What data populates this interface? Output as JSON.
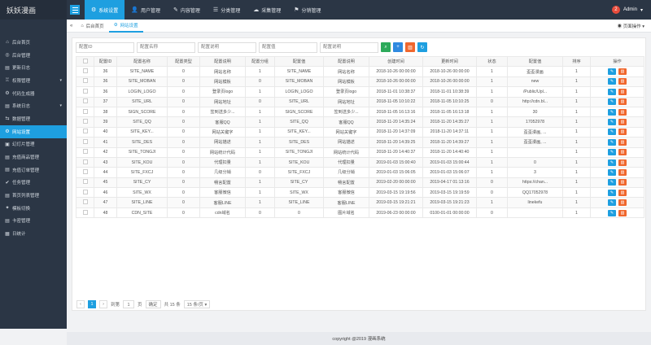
{
  "app": {
    "logo": "妖妖漫画",
    "user": "Admin",
    "avatar_letter": "2"
  },
  "colors": {
    "accent": "#1e9fe0",
    "sidebar": "#2b3645",
    "edit": "#1e9fe0",
    "delete": "#f0672d",
    "search": "#2daa5b"
  },
  "topnav": [
    {
      "label": "系统设置",
      "icon": "⚙"
    },
    {
      "label": "用户管理",
      "icon": "👤"
    },
    {
      "label": "内容管理",
      "icon": "✎"
    },
    {
      "label": "分类管理",
      "icon": "☰"
    },
    {
      "label": "采集管理",
      "icon": "☁"
    },
    {
      "label": "分销管理",
      "icon": "⚑"
    }
  ],
  "sidebar": [
    {
      "label": "后台首页",
      "icon": "⌂"
    },
    {
      "label": "后台管理",
      "icon": "◎"
    },
    {
      "label": "更新日志",
      "icon": "▤"
    },
    {
      "label": "权限管理",
      "icon": "♖",
      "arrow": "▾"
    },
    {
      "label": "代码生成器",
      "icon": "⚙"
    },
    {
      "label": "系统日志",
      "icon": "▤",
      "arrow": "▾"
    },
    {
      "label": "数据管理",
      "icon": "⇆"
    },
    {
      "label": "网站设置",
      "icon": "⚙",
      "active": true
    },
    {
      "label": "幻灯片管理",
      "icon": "▣"
    },
    {
      "label": "充值商品管理",
      "icon": "▤"
    },
    {
      "label": "充值订单管理",
      "icon": "▤"
    },
    {
      "label": "任务管理",
      "icon": "✔"
    },
    {
      "label": "首页列表管理",
      "icon": "▤"
    },
    {
      "label": "模板切换",
      "icon": "✦"
    },
    {
      "label": "卡密管理",
      "icon": "▤"
    },
    {
      "label": "日统计",
      "icon": "▦"
    }
  ],
  "tabs": [
    {
      "label": "后台首页",
      "icon": "⌂"
    },
    {
      "label": "网站设置",
      "icon": "⚙"
    }
  ],
  "page_op": "页面操作",
  "search": {
    "placeholders": [
      "配置ID",
      "配置名称",
      "配置说明",
      "配置值",
      "配置说明"
    ]
  },
  "table": {
    "headers": [
      "",
      "配置ID",
      "配置名称",
      "配置类型",
      "配置说明",
      "配置分组",
      "配置值",
      "配置说明",
      "创建时间",
      "更新时间",
      "状态",
      "配置值",
      "排序",
      "操作"
    ],
    "rows": [
      [
        "36",
        "SITE_NAME",
        "0",
        "网站名称",
        "1",
        "SITE_NAME",
        "网站名称",
        "2018-10-26 00:00:00",
        "2018-10-26 00:00:00",
        "1",
        "歪歪漫画",
        "1"
      ],
      [
        "36",
        "SITE_MOBAN",
        "0",
        "网站模板",
        "0",
        "SITE_MOBAN",
        "网站模板",
        "2018-10-26 00:00:00",
        "2018-10-26 00:00:00",
        "1",
        "new",
        "1"
      ],
      [
        "36",
        "LOGIN_LOGO",
        "0",
        "登录页logo",
        "1",
        "LOGIN_LOGO",
        "登录页logo",
        "2018-11-01 10:38:37",
        "2018-11-01 10:38:39",
        "1",
        "/Public/Upl...",
        "1"
      ],
      [
        "37",
        "SITE_URL",
        "0",
        "网站地址",
        "0",
        "SITE_URL",
        "网站地址",
        "2018-11-05 10:10:22",
        "2018-11-05 10:10:25",
        "0",
        "http://cdn.bl...",
        "1"
      ],
      [
        "38",
        "SIGN_SCORE",
        "0",
        "签到送多少...",
        "1",
        "SIGN_SCORE",
        "签到送多少...",
        "2018-11-05 16:13:16",
        "2018-11-05 16:13:18",
        "1",
        "30",
        "1"
      ],
      [
        "39",
        "SITE_QQ",
        "0",
        "客服QQ",
        "1",
        "SITE_QQ",
        "客服QQ",
        "2018-11-20 14:35:24",
        "2018-11-20 14:35:27",
        "1",
        "17052978",
        "1"
      ],
      [
        "40",
        "SITE_KEY...",
        "0",
        "网站关键字",
        "1",
        "SITE_KEY...",
        "网站关键字",
        "2018-11-20 14:37:09",
        "2018-11-20 14:37:11",
        "1",
        "歪歪漫画, ...",
        "1"
      ],
      [
        "41",
        "SITE_DES",
        "0",
        "网站描述",
        "1",
        "SITE_DES",
        "网站描述",
        "2018-11-20 14:39:25",
        "2018-11-20 14:39:27",
        "1",
        "歪歪漫画, ...",
        "1"
      ],
      [
        "42",
        "SITE_TONGJI",
        "0",
        "网站统计代码",
        "1",
        "SITE_TONGJI",
        "网站统计代码",
        "2018-11-20 14:40:37",
        "2018-11-20 14:40:40",
        "1",
        "",
        "1"
      ],
      [
        "43",
        "SITE_KOU",
        "0",
        "代理扣量",
        "1",
        "SITE_KOU",
        "代理扣量",
        "2019-01-03 15:00:40",
        "2019-01-03 15:00:44",
        "1",
        "0",
        "1"
      ],
      [
        "44",
        "SITE_FXCJ",
        "0",
        "几级分销",
        "0",
        "SITE_FXCJ",
        "几级分销",
        "2019-01-03 15:06:05",
        "2019-01-03 15:06:07",
        "1",
        "3",
        "1"
      ],
      [
        "45",
        "SITE_CY",
        "0",
        "畅言配置",
        "1",
        "SITE_CY",
        "畅言配置",
        "2019-02-20 00:00:00",
        "2019-04-17 01:13:16",
        "0",
        "https://chan...",
        "1"
      ],
      [
        "46",
        "SITE_WX",
        "0",
        "客服微信",
        "1",
        "SITE_WX",
        "客服微信",
        "2019-03-15 19:19:56",
        "2019-03-15 19:19:59",
        "0",
        "QQ17052978",
        "1"
      ],
      [
        "47",
        "SITE_LINE",
        "0",
        "客服LINE",
        "1",
        "SITE_LINE",
        "客服LINE",
        "2019-03-15 19:21:21",
        "2019-03-15 19:21:23",
        "1",
        "linekefu",
        "1"
      ],
      [
        "48",
        "CDN_SITE",
        "0",
        "cdn域名",
        "0",
        "0",
        "图片域名",
        "2019-06-23 00:00:00",
        "0100-01-01 00:00:00",
        "0",
        "",
        "1"
      ]
    ]
  },
  "pager": {
    "current": "1",
    "goto_label": "到第",
    "goto_value": "1",
    "page_label": "页",
    "ok": "确定",
    "total": "共 15 条",
    "per_page": "15 条/页"
  },
  "footer": "copyright @2019 漫画系统"
}
